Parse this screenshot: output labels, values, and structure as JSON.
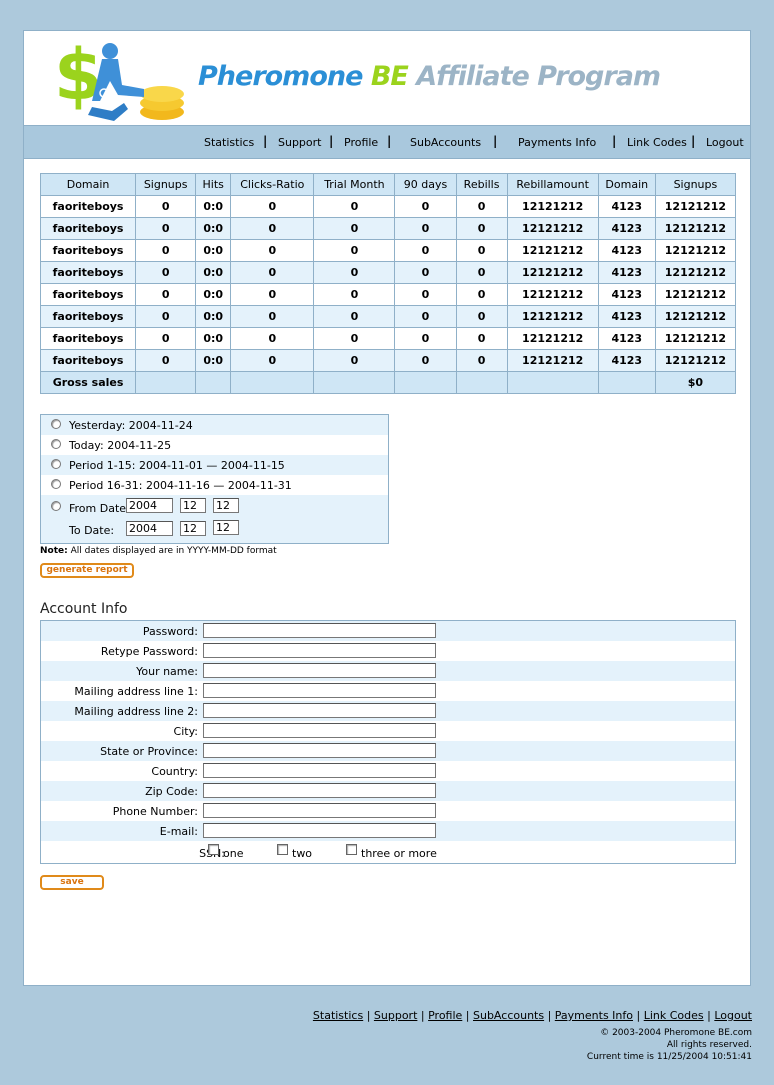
{
  "brand": {
    "part1": "Pheromone ",
    "part2": "BE",
    "part3": " Affiliate Program"
  },
  "nav": [
    "Statistics",
    "Support",
    "Profile",
    "SubAccounts",
    "Payments Info",
    "Link Codes",
    "Logout"
  ],
  "stats": {
    "headers": [
      "Domain",
      "Signups",
      "Hits",
      "Clicks-Ratio",
      "Trial Month",
      "90 days",
      "Rebills",
      "Rebillamount",
      "Domain",
      "Signups"
    ],
    "rows": [
      [
        "faoriteboys",
        "0",
        "0:0",
        "0",
        "0",
        "0",
        "0",
        "12121212",
        "4123",
        "12121212"
      ],
      [
        "faoriteboys",
        "0",
        "0:0",
        "0",
        "0",
        "0",
        "0",
        "12121212",
        "4123",
        "12121212"
      ],
      [
        "faoriteboys",
        "0",
        "0:0",
        "0",
        "0",
        "0",
        "0",
        "12121212",
        "4123",
        "12121212"
      ],
      [
        "faoriteboys",
        "0",
        "0:0",
        "0",
        "0",
        "0",
        "0",
        "12121212",
        "4123",
        "12121212"
      ],
      [
        "faoriteboys",
        "0",
        "0:0",
        "0",
        "0",
        "0",
        "0",
        "12121212",
        "4123",
        "12121212"
      ],
      [
        "faoriteboys",
        "0",
        "0:0",
        "0",
        "0",
        "0",
        "0",
        "12121212",
        "4123",
        "12121212"
      ],
      [
        "faoriteboys",
        "0",
        "0:0",
        "0",
        "0",
        "0",
        "0",
        "12121212",
        "4123",
        "12121212"
      ],
      [
        "faoriteboys",
        "0",
        "0:0",
        "0",
        "0",
        "0",
        "0",
        "12121212",
        "4123",
        "12121212"
      ]
    ],
    "total_label": "Gross sales",
    "total_value": "$0"
  },
  "period": {
    "yesterday": "Yesterday: 2004-11-24",
    "today": "Today: 2004-11-25",
    "period1": "Period 1-15: 2004-11-01 — 2004-11-15",
    "period2": "Period 16-31: 2004-11-16 — 2004-11-31",
    "from_label": "From Date:",
    "to_label": "To Date:",
    "from": {
      "year": "2004",
      "month": "12",
      "day": "12"
    },
    "to": {
      "year": "2004",
      "month": "12",
      "day": "12"
    }
  },
  "note": {
    "bold": "Note:",
    "text": " All dates displayed are in YYYY-MM-DD format"
  },
  "generate_label": "generate report",
  "account": {
    "title": "Account Info",
    "fields": [
      "Password:",
      "Retype Password:",
      "Your name:",
      "Mailing address line 1:",
      "Mailing address line 2:",
      "City:",
      "State or Province:",
      "Country:",
      "Zip Code:",
      "Phone Number:",
      "E-mail:"
    ],
    "ssn_label": "SSN:",
    "ssn_options": [
      "one",
      "two",
      "three or more"
    ]
  },
  "save_label": "save",
  "footer": {
    "links": [
      "Statistics",
      "Support",
      "Profile",
      "SubAccounts",
      "Payments Info",
      "Link Codes",
      "Logout"
    ],
    "copyright": "© 2003-2004 Pheromone BE.com",
    "rights": "All rights reserved.",
    "current_time": "Current time is 11/25/2004 10:51:41"
  },
  "colors": {
    "background": "#adc9dc",
    "navbar": "#a9c8dd",
    "row_blue": "#e4f2fb",
    "header_cell": "#cfe6f5",
    "button_orange": "#e08a1a"
  }
}
